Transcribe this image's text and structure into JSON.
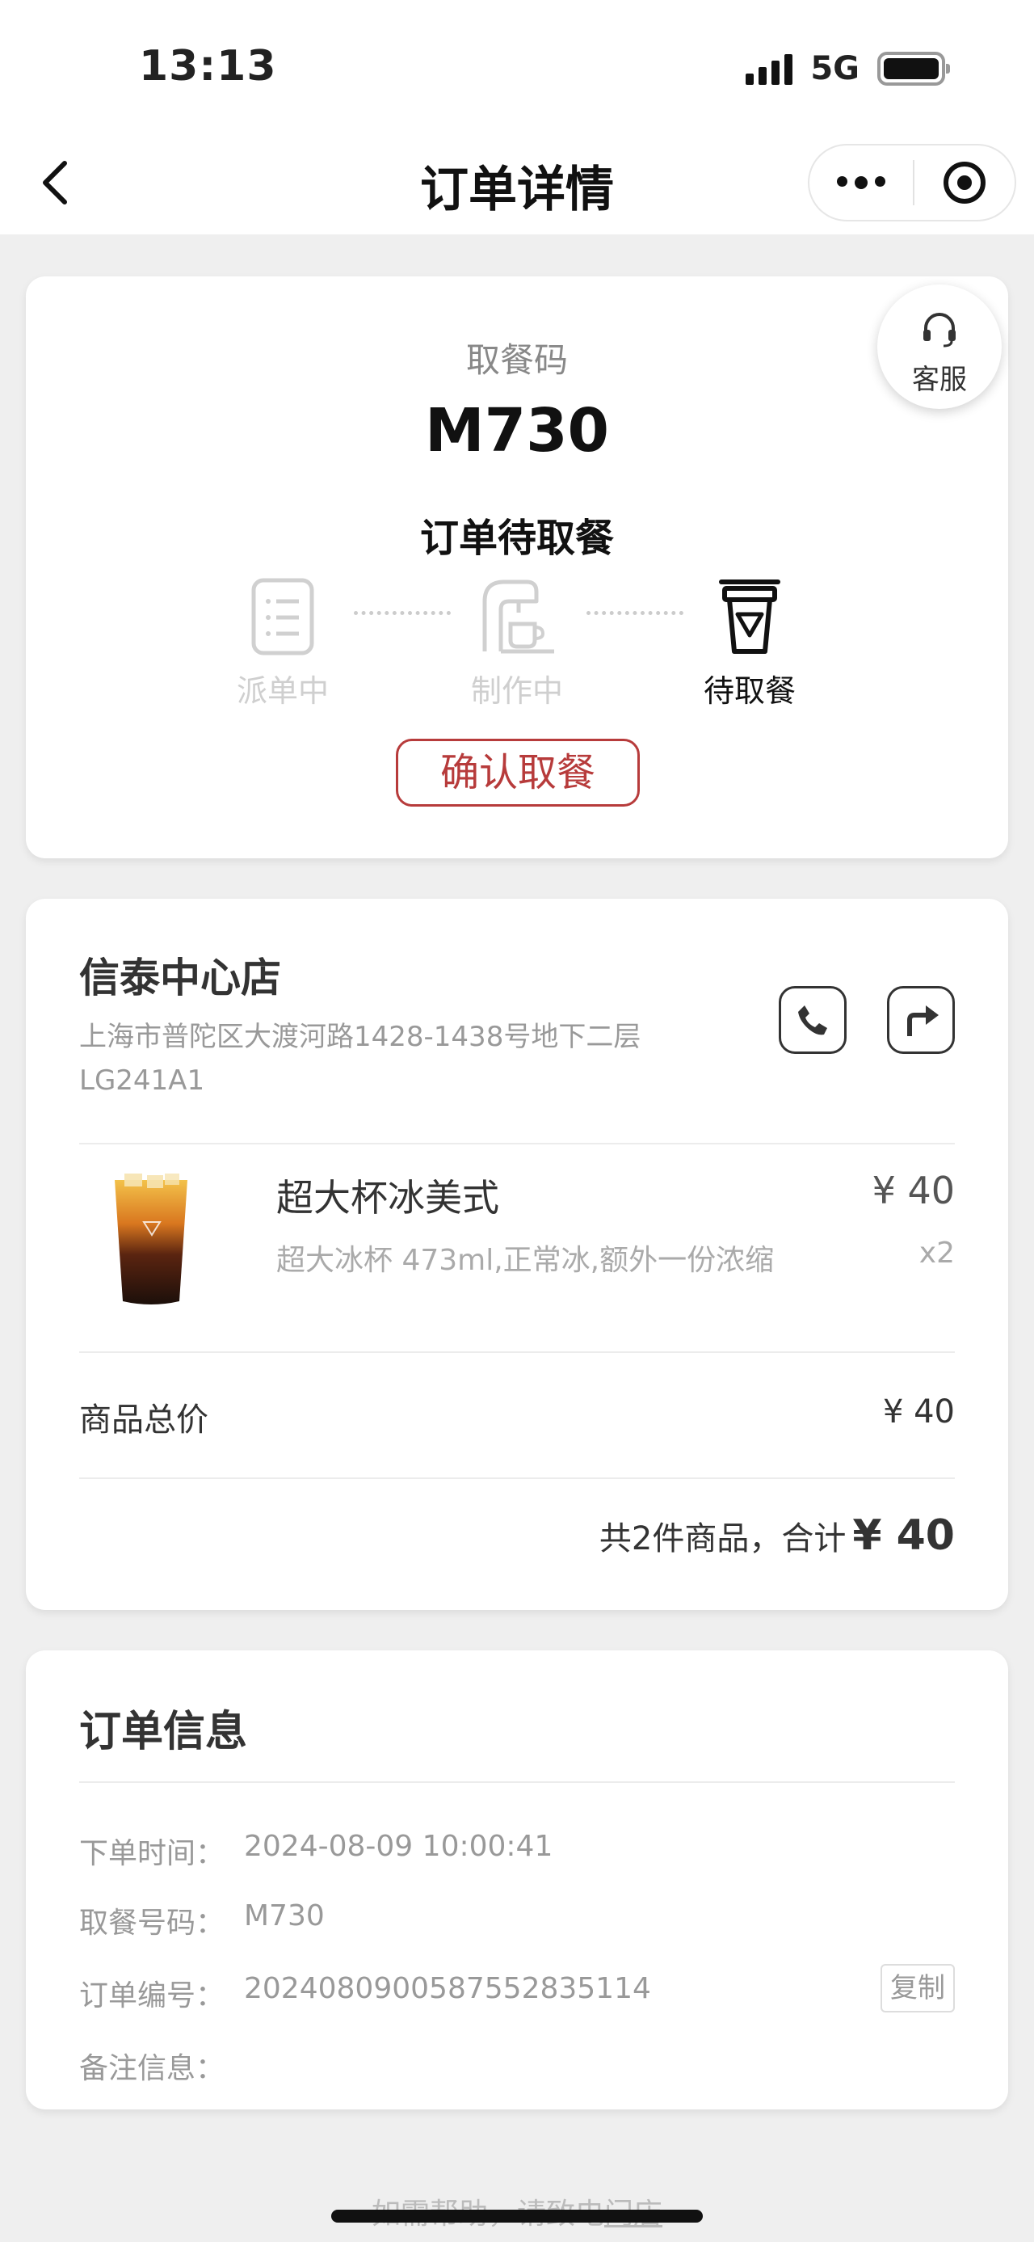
{
  "status_bar": {
    "time": "13:13",
    "network": "5G"
  },
  "nav": {
    "title": "订单详情"
  },
  "pickup": {
    "label": "取餐码",
    "code": "M730",
    "status": "订单待取餐",
    "service_label": "客服",
    "steps": [
      {
        "label": "派单中",
        "icon": "clipboard-icon",
        "active": false
      },
      {
        "label": "制作中",
        "icon": "coffee-machine-icon",
        "active": false
      },
      {
        "label": "待取餐",
        "icon": "cup-icon",
        "active": true
      }
    ],
    "confirm_label": "确认取餐"
  },
  "store": {
    "name": "信泰中心店",
    "address": "上海市普陀区大渡河路1428-1438号地下二层LG241A1",
    "accent_color": "#b73b3b"
  },
  "items": [
    {
      "name": "超大杯冰美式",
      "price": "¥ 40",
      "spec": "超大冰杯 473ml,正常冰,额外一份浓缩",
      "qty": "x2"
    }
  ],
  "summary": {
    "subtotal_label": "商品总价",
    "subtotal_value": "¥ 40",
    "total_prefix": "共2件商品，合计",
    "total_value": "¥ 40"
  },
  "order_info": {
    "title": "订单信息",
    "rows": [
      {
        "key": "下单时间：",
        "value": "2024-08-09 10:00:41"
      },
      {
        "key": "取餐号码：",
        "value": "M730"
      },
      {
        "key": "订单编号：",
        "value": "20240809005875528351​14"
      },
      {
        "key": "备注信息：",
        "value": ""
      }
    ],
    "copy_label": "复制"
  },
  "footer": {
    "hint_prefix": "如需帮助，请致电",
    "hint_link": "门店"
  }
}
